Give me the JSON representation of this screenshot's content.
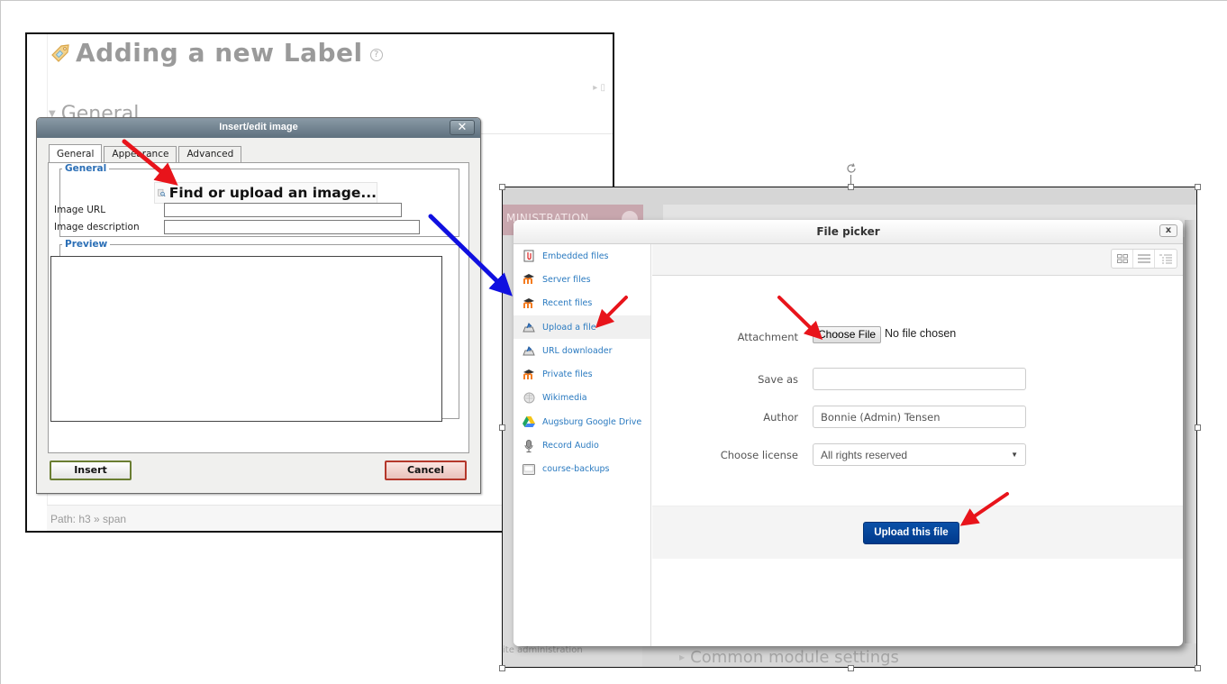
{
  "left_screenshot": {
    "page_title": "Adding a new Label",
    "help_icon": "?",
    "section_heading": "General",
    "path_text": "Path: h3 » span"
  },
  "insert_image_dialog": {
    "title": "Insert/edit image",
    "close_label": "✕",
    "tabs": [
      {
        "label": "General",
        "active": true
      },
      {
        "label": "Appearance",
        "active": false
      },
      {
        "label": "Advanced",
        "active": false
      }
    ],
    "general_legend": "General",
    "find_upload_label": "Find or upload an image...",
    "image_url_label": "Image URL",
    "image_url_value": "",
    "image_description_label": "Image description",
    "image_description_value": "",
    "preview_legend": "Preview",
    "insert_label": "Insert",
    "cancel_label": "Cancel"
  },
  "right_screenshot": {
    "background": {
      "admin_block_label": "MINISTRATION",
      "site_admin_label": "ite administration",
      "common_settings_label": "Common module settings"
    },
    "file_picker": {
      "title": "File picker",
      "close_label": "x",
      "repositories": [
        {
          "label": "Embedded files",
          "icon": "embedded-files-icon",
          "active": false
        },
        {
          "label": "Server files",
          "icon": "moodle-icon",
          "active": false
        },
        {
          "label": "Recent files",
          "icon": "moodle-icon",
          "active": false
        },
        {
          "label": "Upload a file",
          "icon": "upload-icon",
          "active": true
        },
        {
          "label": "URL downloader",
          "icon": "url-download-icon",
          "active": false
        },
        {
          "label": "Private files",
          "icon": "moodle-icon",
          "active": false
        },
        {
          "label": "Wikimedia",
          "icon": "wikimedia-icon",
          "active": false
        },
        {
          "label": "Augsburg Google Drive",
          "icon": "google-drive-icon",
          "active": false
        },
        {
          "label": "Record Audio",
          "icon": "microphone-icon",
          "active": false
        },
        {
          "label": "course-backups",
          "icon": "folder-icon",
          "active": false
        }
      ],
      "view_modes": [
        "icons-view",
        "list-view",
        "tree-view"
      ],
      "form": {
        "attachment_label": "Attachment",
        "choose_file_label": "Choose File",
        "no_file_text": "No file chosen",
        "save_as_label": "Save as",
        "save_as_value": "",
        "author_label": "Author",
        "author_value": "Bonnie (Admin) Tensen",
        "license_label": "Choose license",
        "license_value": "All rights reserved"
      },
      "upload_button_label": "Upload this file"
    }
  },
  "annotations": {
    "arrow_colors": {
      "red": "#e8141b",
      "blue": "#1010e0"
    }
  }
}
